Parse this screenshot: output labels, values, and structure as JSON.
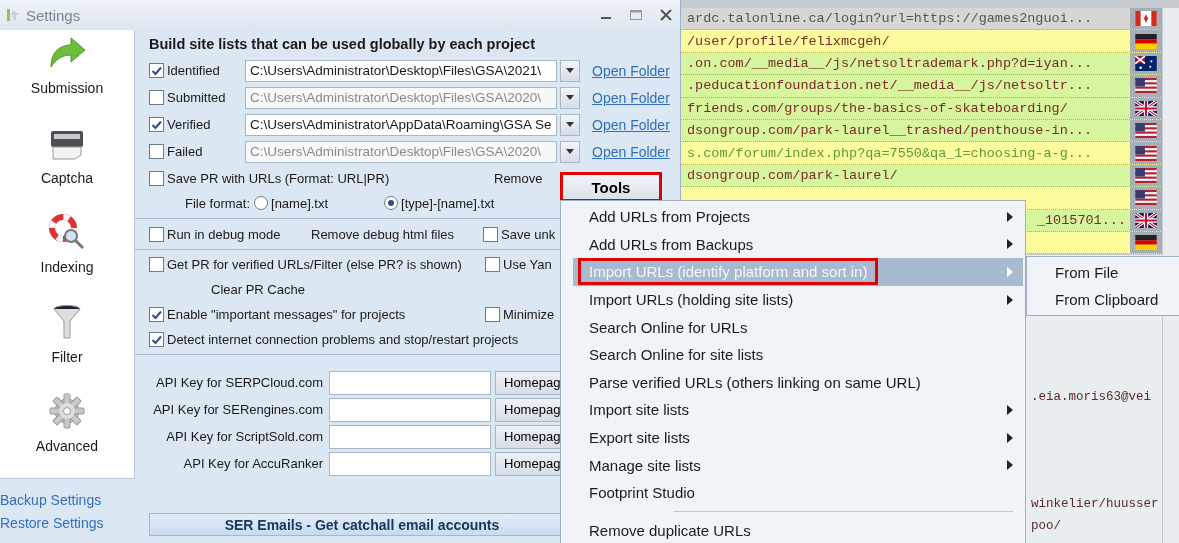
{
  "window": {
    "title": "Settings"
  },
  "sidebar": {
    "items": [
      {
        "label": "Submission"
      },
      {
        "label": "Captcha"
      },
      {
        "label": "Indexing"
      },
      {
        "label": "Filter"
      },
      {
        "label": "Advanced"
      }
    ],
    "links": [
      "Backup Settings",
      "Restore Settings"
    ]
  },
  "site_lists": {
    "heading": "Build site lists that can be used globally by each project",
    "rows": [
      {
        "label": "Identified",
        "checked": true,
        "path": "C:\\Users\\Administrator\\Desktop\\Files\\GSA\\2021\\",
        "disabled": false,
        "link": "Open Folder"
      },
      {
        "label": "Submitted",
        "checked": false,
        "path": "C:\\Users\\Administrator\\Desktop\\Files\\GSA\\2020\\",
        "disabled": true,
        "link": "Open Folder"
      },
      {
        "label": "Verified",
        "checked": true,
        "path": "C:\\Users\\Administrator\\AppData\\Roaming\\GSA Se",
        "disabled": false,
        "link": "Open Folder"
      },
      {
        "label": "Failed",
        "checked": false,
        "path": "C:\\Users\\Administrator\\Desktop\\Files\\GSA\\2020\\",
        "disabled": true,
        "link": "Open Folder"
      }
    ]
  },
  "save_pr": {
    "label": "Save PR with URLs (Format: URL|PR)",
    "checked": false,
    "remove": "Remove"
  },
  "file_format": {
    "label": "File format:",
    "options": [
      {
        "label": "[name].txt",
        "selected": false
      },
      {
        "label": "[type]-[name].txt",
        "selected": true
      }
    ]
  },
  "tools_button": {
    "label": "Tools",
    "annotated": true
  },
  "debug": {
    "label": "Run in debug mode",
    "checked": false,
    "button": "Remove debug html files",
    "extra": {
      "label": "Save unk",
      "checked": false
    }
  },
  "pr": {
    "label": "Get PR for verified URLs/Filter  (else PR? is shown)",
    "checked": false,
    "extra": {
      "label": "Use Yan",
      "checked": false
    },
    "button": "Clear PR Cache"
  },
  "messages": [
    {
      "label": "Enable \"important messages\" for projects",
      "checked": true
    },
    {
      "label": "Detect internet connection problems and stop/restart projects",
      "checked": true
    }
  ],
  "minimize": {
    "label": "Minimize",
    "checked": false
  },
  "api_keys": [
    {
      "label": "API Key for SERPCloud.com",
      "button": "Homepag"
    },
    {
      "label": "API Key for SERengines.com",
      "button": "Homepag"
    },
    {
      "label": "API Key for ScriptSold.com",
      "button": "Homepag"
    },
    {
      "label": "API Key for AccuRanker",
      "button": "Homepag"
    }
  ],
  "ser_emails_button": "SER Emails - Get catchall email accounts",
  "url_list": {
    "rows": [
      {
        "url": "ardc.talonline.ca/login?url=https://games2nguoi...",
        "color": "#d6d6d6",
        "kind": "dim"
      },
      {
        "url": "/user/profile/felixmcgeh/",
        "color": "#fbfb9c",
        "kind": "normal"
      },
      {
        "url": ".on.com/__media__/js/netsoltrademark.php?d=iyan...",
        "color": "#d6f59c",
        "kind": "normal"
      },
      {
        "url": ".peducationfoundation.net/__media__/js/netsoltr...",
        "color": "#d6f59c",
        "kind": "normal"
      },
      {
        "url": "friends.com/groups/the-basics-of-skateboarding/",
        "color": "#d6f59c",
        "kind": "normal"
      },
      {
        "url": "dsongroup.com/park-laurel__trashed/penthouse-in...",
        "color": "#d6f59c",
        "kind": "normal"
      },
      {
        "url": "s.com/forum/index.php?qa=7550&qa_1=choosing-a-g...",
        "color": "#fbfb9c",
        "kind": "alt"
      },
      {
        "url": "dsongroup.com/park-laurel/",
        "color": "#d6f59c",
        "kind": "normal"
      },
      {
        "color": "#fbfb9c",
        "kind": "normal"
      },
      {
        "url": "_1015701...",
        "color": "#d6f59c",
        "kind": "normal",
        "partial": true
      },
      {
        "color": "#fbfb9c",
        "kind": "normal"
      }
    ]
  },
  "log_lines": [
    ".eia.moris63@vei",
    "winkelier/huusser",
    "poo/"
  ],
  "context_menu": {
    "items": [
      {
        "kind": "item",
        "label": "Add URLs from Projects",
        "submenu": true,
        "selected": false,
        "annotated": false
      },
      {
        "kind": "item",
        "label": "Add URLs from Backups",
        "submenu": true,
        "selected": false,
        "annotated": false
      },
      {
        "kind": "item",
        "label": "Import URLs (identify platform and sort in)",
        "submenu": true,
        "selected": true,
        "annotated": true
      },
      {
        "kind": "item",
        "label": "Import URLs (holding site lists)",
        "submenu": true,
        "selected": false,
        "annotated": false
      },
      {
        "kind": "item",
        "label": "Search Online for URLs",
        "submenu": false,
        "selected": false,
        "annotated": false
      },
      {
        "kind": "item",
        "label": "Search Online for site lists",
        "submenu": false,
        "selected": false,
        "annotated": false
      },
      {
        "kind": "item",
        "label": "Parse verified URLs (others linking on same URL)",
        "submenu": false,
        "selected": false,
        "annotated": false
      },
      {
        "kind": "item",
        "label": "Import site lists",
        "submenu": true,
        "selected": false,
        "annotated": false
      },
      {
        "kind": "item",
        "label": "Export site lists",
        "submenu": true,
        "selected": false,
        "annotated": false
      },
      {
        "kind": "item",
        "label": "Manage site lists",
        "submenu": true,
        "selected": false,
        "annotated": false
      },
      {
        "kind": "item",
        "label": "Footprint Studio",
        "submenu": false,
        "selected": false,
        "annotated": false
      },
      {
        "kind": "separator"
      },
      {
        "kind": "item",
        "label": "Remove duplicate URLs",
        "submenu": false,
        "selected": false,
        "annotated": false
      }
    ]
  },
  "submenu": {
    "items": [
      {
        "label": "From File"
      },
      {
        "label": "From Clipboard"
      }
    ]
  }
}
